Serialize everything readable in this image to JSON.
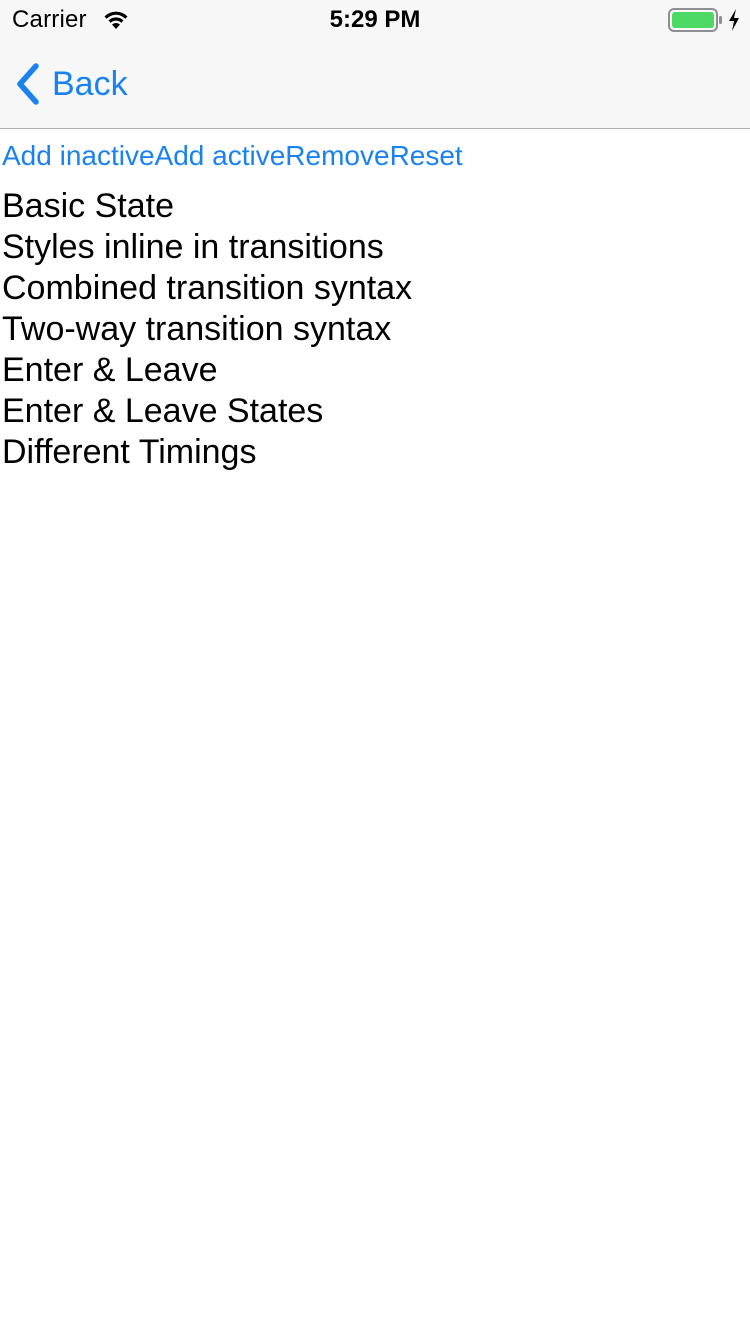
{
  "status_bar": {
    "carrier": "Carrier",
    "time": "5:29 PM",
    "wifi_icon": "wifi-icon",
    "battery_icon": "battery-icon",
    "charging_icon": "charging-bolt-icon",
    "battery_color": "#4cd964"
  },
  "nav": {
    "back_label": "Back",
    "back_icon": "chevron-left-icon",
    "accent_color": "#1a82f0"
  },
  "actions": {
    "add_inactive": "Add inactive",
    "add_active": "Add active",
    "remove": "Remove",
    "reset": "Reset"
  },
  "items": [
    "Basic State",
    "Styles inline in transitions",
    "Combined transition syntax",
    "Two-way transition syntax",
    "Enter & Leave",
    "Enter & Leave States",
    "Different Timings"
  ]
}
